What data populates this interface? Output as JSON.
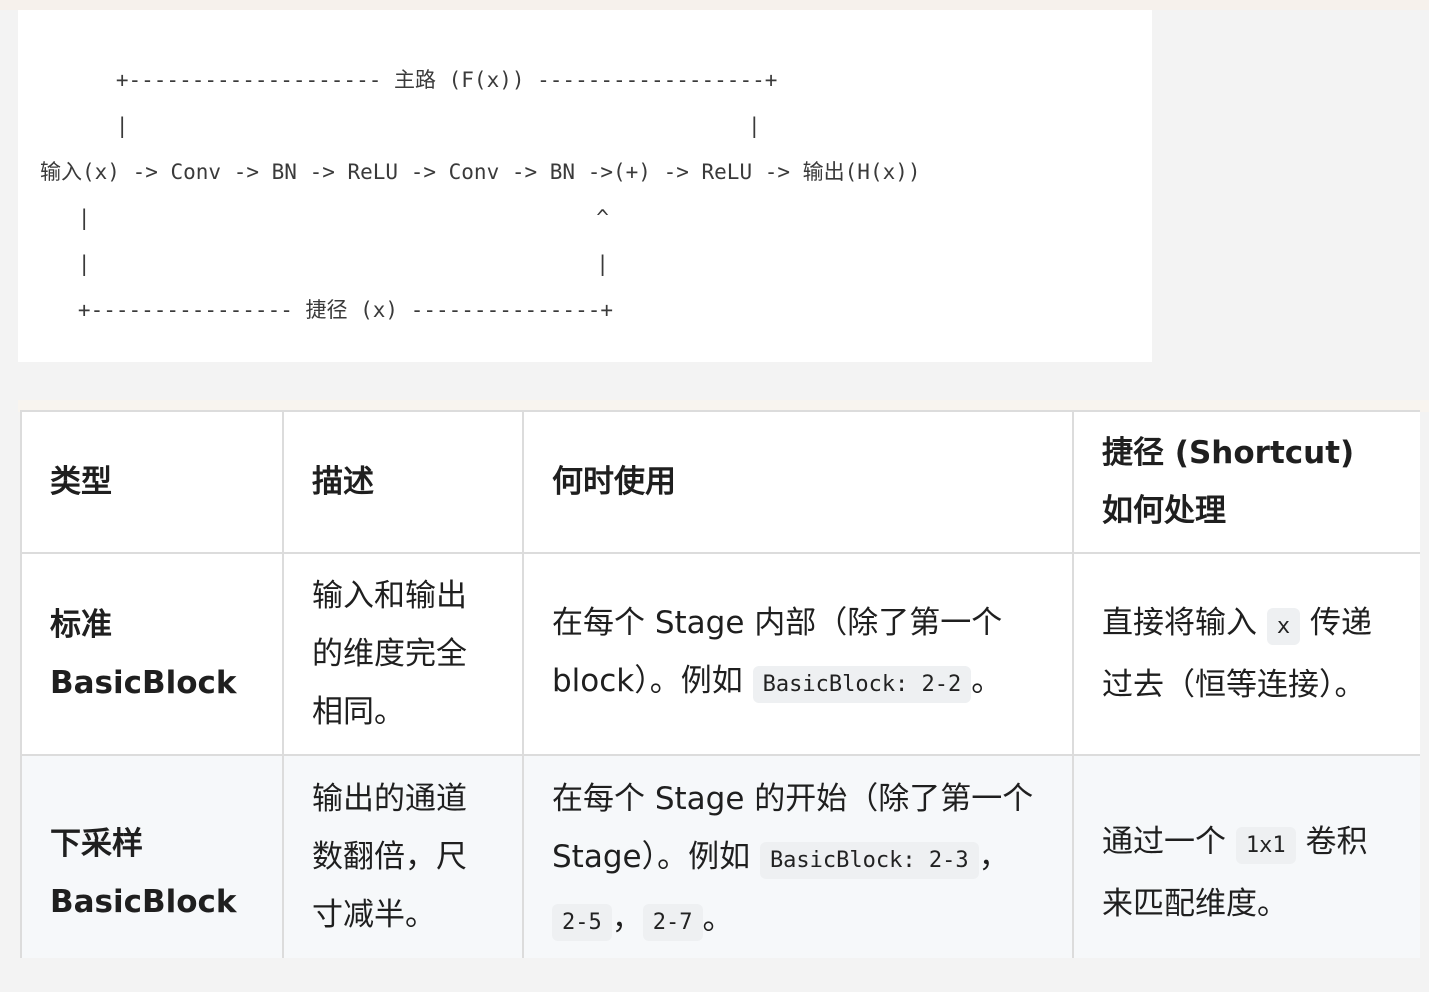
{
  "diagram": {
    "lines": [
      "      +-------------------- 主路 (F(x)) ------------------+",
      "      |                                                 |",
      "输入(x) -> Conv -> BN -> ReLU -> Conv -> BN ->(+) -> ReLU -> 输出(H(x))",
      "   |                                        ^",
      "   |                                        |",
      "   +---------------- 捷径 (x) ---------------+"
    ]
  },
  "table": {
    "headers": [
      "类型",
      "描述",
      "何时使用",
      "捷径 (Shortcut) 如何处理"
    ],
    "rows": [
      {
        "type_line1": "标准",
        "type_line2": "BasicBlock",
        "description": "输入和输出的维度完全相同。",
        "when_text1": "在每个 Stage 内部（除了第一个 block）。例如 ",
        "when_code1": "BasicBlock: 2-2",
        "when_text2": "。",
        "shortcut_text1": "直接将输入 ",
        "shortcut_code": "x",
        "shortcut_text2": " 传递过去（恒等连接）。"
      },
      {
        "type_line1": "下采样",
        "type_line2": "BasicBlock",
        "description": "输出的通道数翻倍，尺寸减半。",
        "when_text1": "在每个 Stage 的开始（除了第一个 Stage）。例如 ",
        "when_code1": "BasicBlock: 2-3",
        "when_sep1": "，",
        "when_code2": "2-5",
        "when_sep2": "，",
        "when_code3": "2-7",
        "when_text2": "。",
        "shortcut_text1": "通过一个 ",
        "shortcut_code": "1x1",
        "shortcut_text2": " 卷积来匹配维度。"
      }
    ]
  }
}
